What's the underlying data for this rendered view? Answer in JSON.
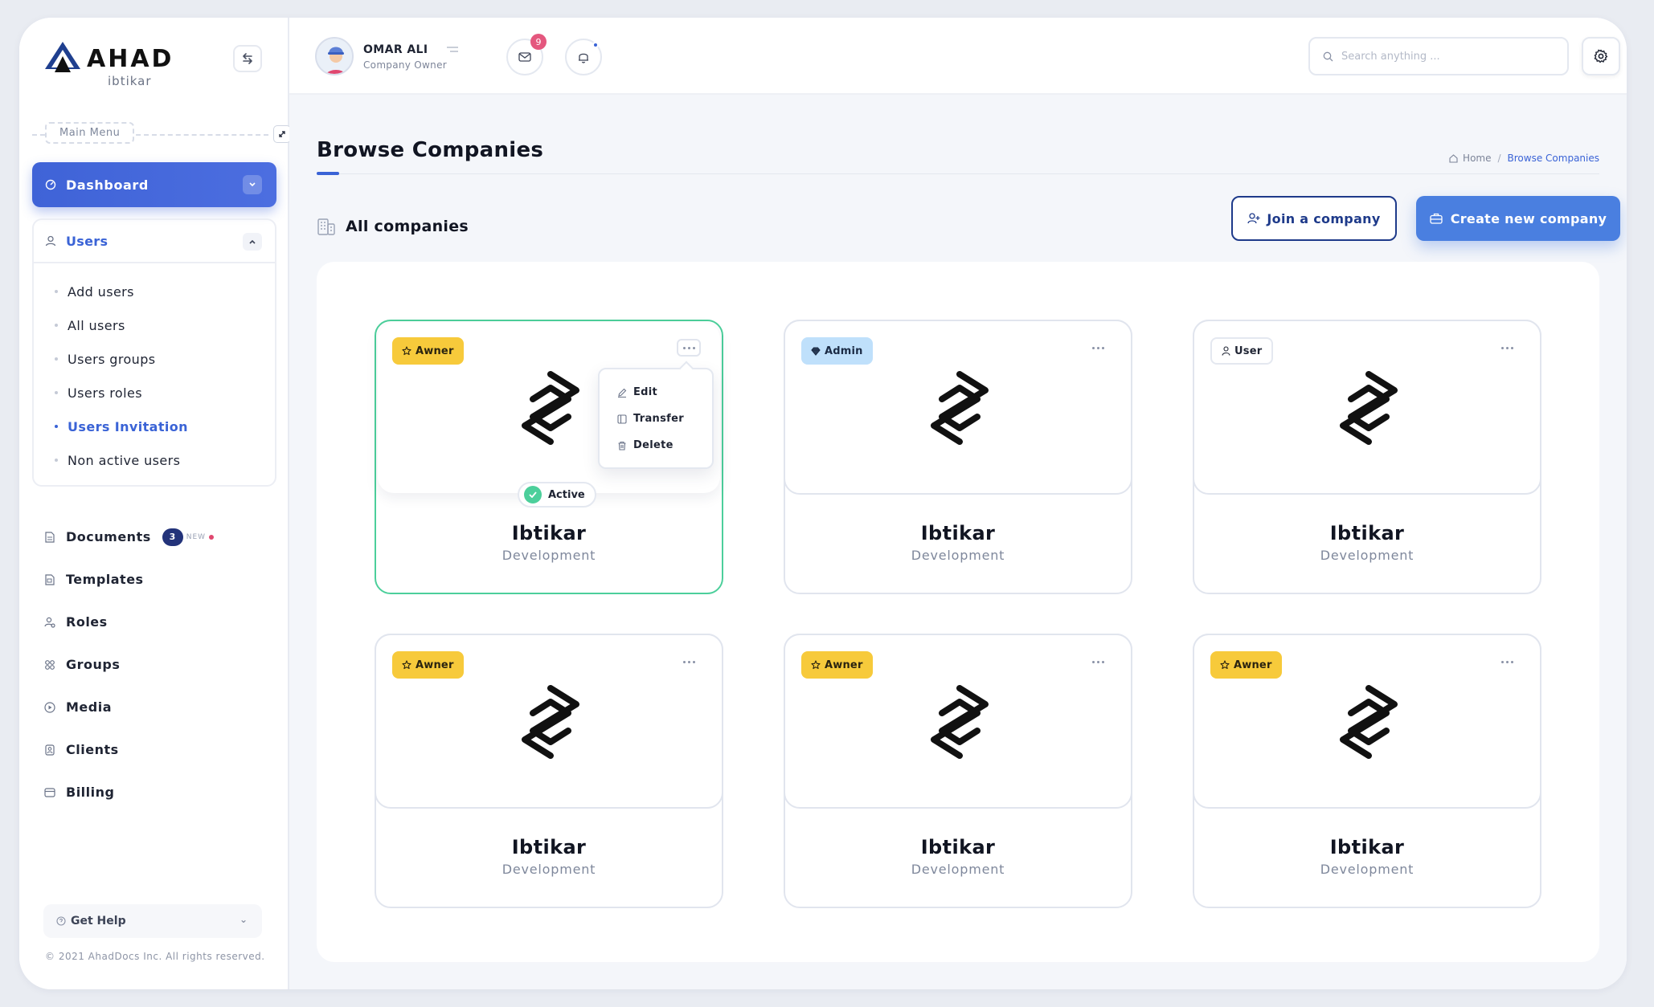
{
  "brand": {
    "name": "AHAD",
    "sub": "ibtikar"
  },
  "sidebar": {
    "main_menu_label": "Main Menu",
    "dashboard_label": "Dashboard",
    "users_label": "Users",
    "users_items": [
      {
        "label": "Add users",
        "active": false
      },
      {
        "label": "All users",
        "active": false
      },
      {
        "label": "Users groups",
        "active": false
      },
      {
        "label": "Users roles",
        "active": false
      },
      {
        "label": "Users Invitation",
        "active": true
      },
      {
        "label": "Non active users",
        "active": false
      }
    ],
    "nav": [
      {
        "label": "Documents",
        "icon": "document-icon",
        "badge_count": "3",
        "badge_new": "NEW"
      },
      {
        "label": "Templates",
        "icon": "template-icon"
      },
      {
        "label": "Roles",
        "icon": "roles-icon"
      },
      {
        "label": "Groups",
        "icon": "groups-icon"
      },
      {
        "label": "Media",
        "icon": "media-icon"
      },
      {
        "label": "Clients",
        "icon": "clients-icon"
      },
      {
        "label": "Billing",
        "icon": "billing-icon"
      }
    ],
    "help_label": "Get Help",
    "copyright": "© 2021 AhadDocs Inc. All rights reserved."
  },
  "topbar": {
    "user_name": "OMAR ALI",
    "user_role": "Company Owner",
    "mail_count": "9",
    "search_placeholder": "Search anything ..."
  },
  "page": {
    "title": "Browse Companies",
    "breadcrumb": {
      "home": "Home",
      "current": "Browse Companies"
    },
    "section_title": "All companies",
    "join_label": "Join a company",
    "create_label": "Create new company"
  },
  "cards": [
    {
      "name": "Ibtikar",
      "category": "Development",
      "role": "Awner",
      "role_type": "owner",
      "selected": true,
      "status": "Active"
    },
    {
      "name": "Ibtikar",
      "category": "Development",
      "role": "Admin",
      "role_type": "admin"
    },
    {
      "name": "Ibtikar",
      "category": "Development",
      "role": "User",
      "role_type": "user"
    },
    {
      "name": "Ibtikar",
      "category": "Development",
      "role": "Awner",
      "role_type": "owner"
    },
    {
      "name": "Ibtikar",
      "category": "Development",
      "role": "Awner",
      "role_type": "owner"
    },
    {
      "name": "Ibtikar",
      "category": "Development",
      "role": "Awner",
      "role_type": "owner"
    }
  ],
  "card_menu": {
    "edit": "Edit",
    "transfer": "Transfer",
    "delete": "Delete"
  },
  "colors": {
    "accent": "#3a63d6",
    "create_button": "#4a7fe0",
    "owner_badge": "#f7ca3b",
    "admin_badge": "#bfe0fb",
    "active_green": "#4ccf9b"
  }
}
